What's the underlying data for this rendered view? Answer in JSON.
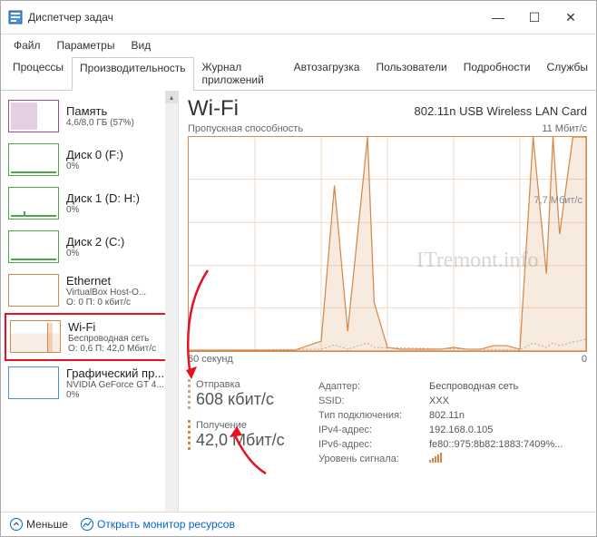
{
  "window": {
    "title": "Диспетчер задач"
  },
  "menu": {
    "file": "Файл",
    "options": "Параметры",
    "view": "Вид"
  },
  "tabs": {
    "processes": "Процессы",
    "performance": "Производительность",
    "apphistory": "Журнал приложений",
    "startup": "Автозагрузка",
    "users": "Пользователи",
    "details": "Подробности",
    "services": "Службы"
  },
  "sidebar": {
    "memory": {
      "title": "Память",
      "sub": "4,6/8,0 ГБ (57%)"
    },
    "disk0": {
      "title": "Диск 0 (F:)",
      "sub": "0%"
    },
    "disk1": {
      "title": "Диск 1 (D: H:)",
      "sub": "0%"
    },
    "disk2": {
      "title": "Диск 2 (C:)",
      "sub": "0%"
    },
    "ethernet": {
      "title": "Ethernet",
      "sub1": "VirtualBox Host-O...",
      "sub2": "О: 0 П: 0 кбит/с"
    },
    "wifi": {
      "title": "Wi-Fi",
      "sub1": "Беспроводная сеть",
      "sub2": "О: 0,6 П: 42,0 Мбит/с"
    },
    "gpu": {
      "title": "Графический пр...",
      "sub1": "NVIDIA GeForce GT 4...",
      "sub2": "0%"
    }
  },
  "main": {
    "title": "Wi-Fi",
    "adapter": "802.11n USB Wireless LAN Card",
    "chart_label": "Пропускная способность",
    "chart_max": "11 Мбит/с",
    "chart_mid": "7,7 Мбит/с",
    "chart_time": "60 секунд",
    "chart_zero": "0",
    "send_label": "Отправка",
    "send_value": "608 кбит/с",
    "recv_label": "Получение",
    "recv_value": "42,0 Мбит/с",
    "info": {
      "adapter_k": "Адаптер:",
      "adapter_v": "Беспроводная сеть",
      "ssid_k": "SSID:",
      "ssid_v": "XXX",
      "conntype_k": "Тип подключения:",
      "conntype_v": "802.11n",
      "ipv4_k": "IPv4-адрес:",
      "ipv4_v": "192.168.0.105",
      "ipv6_k": "IPv6-адрес:",
      "ipv6_v": "fe80::975:8b82:1883:7409%...",
      "signal_k": "Уровень сигнала:"
    }
  },
  "footer": {
    "less": "Меньше",
    "monitor": "Открыть монитор ресурсов"
  },
  "watermark": "ITremont.info",
  "chart_data": {
    "type": "area",
    "xlabel": "60 секунд",
    "ylabel": "Пропускная способность",
    "ylim": [
      0,
      11
    ],
    "yunit": "Мбит/с",
    "x_seconds": [
      60,
      56,
      52,
      48,
      44,
      40,
      38,
      36,
      33,
      32,
      30,
      28,
      26,
      24,
      22,
      20,
      18,
      16,
      14,
      12,
      10,
      8,
      6,
      5,
      4,
      2,
      1,
      0
    ],
    "series": [
      {
        "name": "Получение",
        "color": "#d4894b",
        "values": [
          0.05,
          0.05,
          0.05,
          0.05,
          0.05,
          0.5,
          8.5,
          1.0,
          11,
          2.5,
          0.2,
          0.1,
          0.1,
          0.1,
          0.1,
          0.2,
          0.1,
          0.1,
          0.3,
          0.3,
          0.1,
          11,
          4.0,
          11,
          6.0,
          11,
          11,
          11
        ]
      },
      {
        "name": "Отправка",
        "color": "#c9a884",
        "values": [
          0.02,
          0.02,
          0.02,
          0.02,
          0.02,
          0.05,
          0.3,
          0.1,
          0.4,
          0.2,
          0.05,
          0.05,
          0.05,
          0.05,
          0.05,
          0.05,
          0.05,
          0.05,
          0.1,
          0.1,
          0.05,
          0.4,
          0.2,
          0.4,
          0.3,
          0.5,
          0.5,
          0.6
        ]
      }
    ]
  }
}
